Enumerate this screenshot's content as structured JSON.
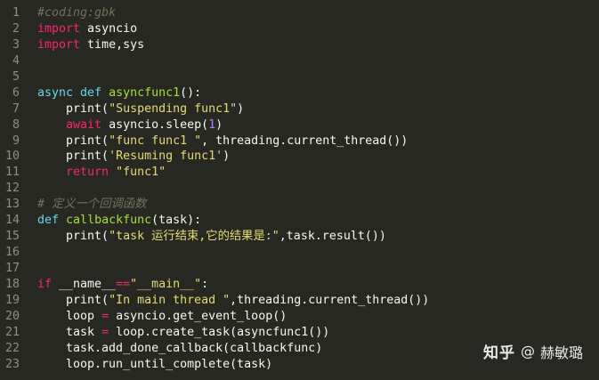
{
  "editor": {
    "lines": [
      {
        "number": "1",
        "tokens": [
          {
            "t": "#coding:gbk",
            "c": "comment"
          }
        ]
      },
      {
        "number": "2",
        "tokens": [
          {
            "t": "import",
            "c": "kw"
          },
          {
            "t": " asyncio",
            "c": "plain"
          }
        ]
      },
      {
        "number": "3",
        "tokens": [
          {
            "t": "import",
            "c": "kw"
          },
          {
            "t": " time,sys",
            "c": "plain"
          }
        ]
      },
      {
        "number": "4",
        "tokens": []
      },
      {
        "number": "5",
        "tokens": []
      },
      {
        "number": "6",
        "tokens": [
          {
            "t": "async",
            "c": "def"
          },
          {
            "t": " ",
            "c": "plain"
          },
          {
            "t": "def",
            "c": "def"
          },
          {
            "t": " ",
            "c": "plain"
          },
          {
            "t": "asyncfunc1",
            "c": "fn"
          },
          {
            "t": "():",
            "c": "plain"
          }
        ]
      },
      {
        "number": "7",
        "tokens": [
          {
            "t": "    print(",
            "c": "plain"
          },
          {
            "t": "\"Suspending func1\"",
            "c": "str"
          },
          {
            "t": ")",
            "c": "plain"
          }
        ]
      },
      {
        "number": "8",
        "tokens": [
          {
            "t": "    ",
            "c": "plain"
          },
          {
            "t": "await",
            "c": "kw"
          },
          {
            "t": " asyncio.sleep(",
            "c": "plain"
          },
          {
            "t": "1",
            "c": "num"
          },
          {
            "t": ")",
            "c": "plain"
          }
        ]
      },
      {
        "number": "9",
        "tokens": [
          {
            "t": "    print(",
            "c": "plain"
          },
          {
            "t": "\"func func1 \"",
            "c": "str"
          },
          {
            "t": ", threading.current_thread())",
            "c": "plain"
          }
        ]
      },
      {
        "number": "10",
        "tokens": [
          {
            "t": "    print(",
            "c": "plain"
          },
          {
            "t": "'Resuming func1'",
            "c": "str"
          },
          {
            "t": ")",
            "c": "plain"
          }
        ]
      },
      {
        "number": "11",
        "tokens": [
          {
            "t": "    ",
            "c": "plain"
          },
          {
            "t": "return",
            "c": "kw"
          },
          {
            "t": " ",
            "c": "plain"
          },
          {
            "t": "\"func1\"",
            "c": "str"
          }
        ]
      },
      {
        "number": "12",
        "tokens": []
      },
      {
        "number": "13",
        "tokens": [
          {
            "t": "# 定义一个回调函数",
            "c": "comment"
          }
        ]
      },
      {
        "number": "14",
        "tokens": [
          {
            "t": "def",
            "c": "def"
          },
          {
            "t": " ",
            "c": "plain"
          },
          {
            "t": "callbackfunc",
            "c": "fn"
          },
          {
            "t": "(task):",
            "c": "plain"
          }
        ]
      },
      {
        "number": "15",
        "tokens": [
          {
            "t": "    print(",
            "c": "plain"
          },
          {
            "t": "\"task 运行结束,它的结果是:\"",
            "c": "str"
          },
          {
            "t": ",task.result())",
            "c": "plain"
          }
        ]
      },
      {
        "number": "16",
        "tokens": []
      },
      {
        "number": "17",
        "tokens": []
      },
      {
        "number": "18",
        "tokens": [
          {
            "t": "if",
            "c": "kw"
          },
          {
            "t": " __name__",
            "c": "plain"
          },
          {
            "t": "==",
            "c": "kw"
          },
          {
            "t": "\"__main__\"",
            "c": "str"
          },
          {
            "t": ":",
            "c": "plain"
          }
        ]
      },
      {
        "number": "19",
        "tokens": [
          {
            "t": "    print(",
            "c": "plain"
          },
          {
            "t": "\"In main thread \"",
            "c": "str"
          },
          {
            "t": ",threading.current_thread())",
            "c": "plain"
          }
        ]
      },
      {
        "number": "20",
        "tokens": [
          {
            "t": "    loop ",
            "c": "plain"
          },
          {
            "t": "=",
            "c": "kw"
          },
          {
            "t": " asyncio.get_event_loop()",
            "c": "plain"
          }
        ]
      },
      {
        "number": "21",
        "tokens": [
          {
            "t": "    task ",
            "c": "plain"
          },
          {
            "t": "=",
            "c": "kw"
          },
          {
            "t": " loop.create_task(asyncfunc1())",
            "c": "plain"
          }
        ]
      },
      {
        "number": "22",
        "tokens": [
          {
            "t": "    task.add_done_callback(callbackfunc)",
            "c": "plain"
          }
        ]
      },
      {
        "number": "23",
        "tokens": [
          {
            "t": "    loop.run_until_complete(task)",
            "c": "plain"
          }
        ]
      }
    ]
  },
  "watermark": {
    "brand": "知乎",
    "at": "@",
    "author": "赫敏璐"
  },
  "colors": {
    "background": "#272822",
    "line_number": "#8f908a",
    "plain": "#f8f8f2",
    "keyword": "#f92672",
    "definition": "#66d9ef",
    "function_name": "#a6e22e",
    "string": "#e6db74",
    "number": "#ae81ff",
    "comment": "#75715e"
  }
}
